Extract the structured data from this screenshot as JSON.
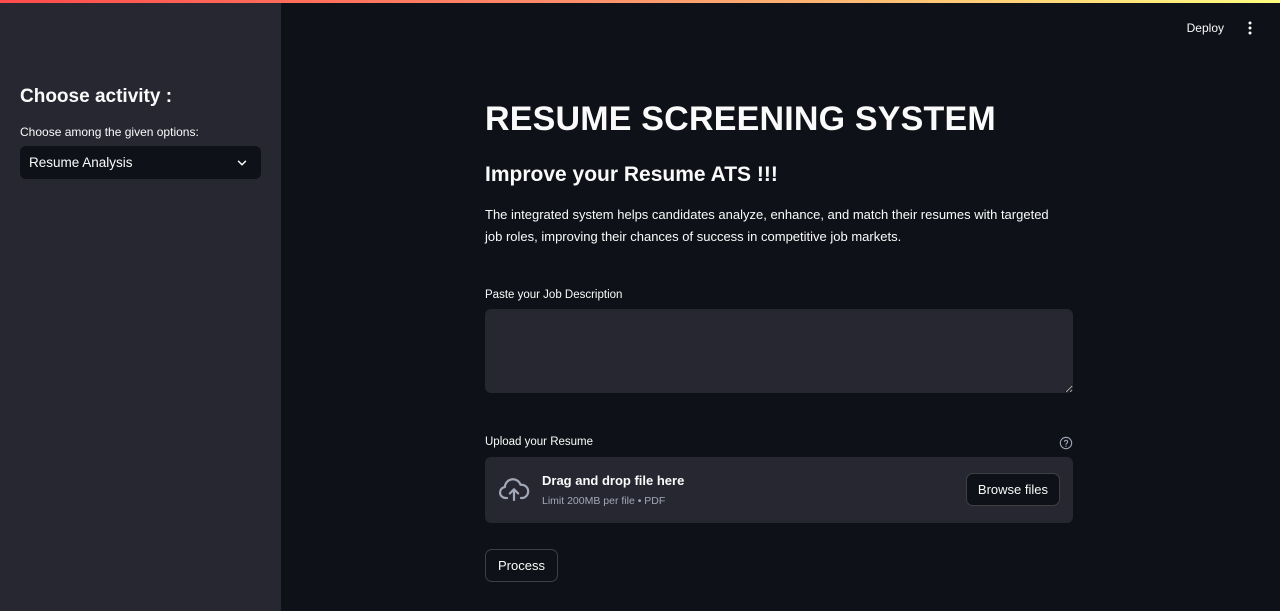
{
  "colors": {
    "background": "#0e1117",
    "sidebar": "#262730",
    "input": "#262730",
    "text": "#fafafa",
    "muted_text": "#a3a8b8",
    "decoration_start": "#ff4b4b",
    "decoration_end": "#fffd80"
  },
  "header": {
    "deploy_label": "Deploy",
    "menu_icon": "more-vertical-icon"
  },
  "sidebar": {
    "heading": "Choose activity :",
    "select": {
      "label": "Choose among the given options:",
      "value": "Resume Analysis",
      "icon": "chevron-down-icon"
    }
  },
  "main": {
    "title": "RESUME SCREENING SYSTEM",
    "subtitle": "Improve your Resume ATS !!!",
    "description": "The integrated system helps candidates analyze, enhance, and match their resumes with targeted job roles, improving their chances of success in competitive job markets.",
    "job_description": {
      "label": "Paste your Job Description",
      "value": ""
    },
    "upload": {
      "label": "Upload your Resume",
      "help_icon": "help-circle-icon",
      "drop_icon": "cloud-upload-icon",
      "drop_title": "Drag and drop file here",
      "drop_limit": "Limit 200MB per file • PDF",
      "browse_label": "Browse files"
    },
    "process_label": "Process"
  }
}
